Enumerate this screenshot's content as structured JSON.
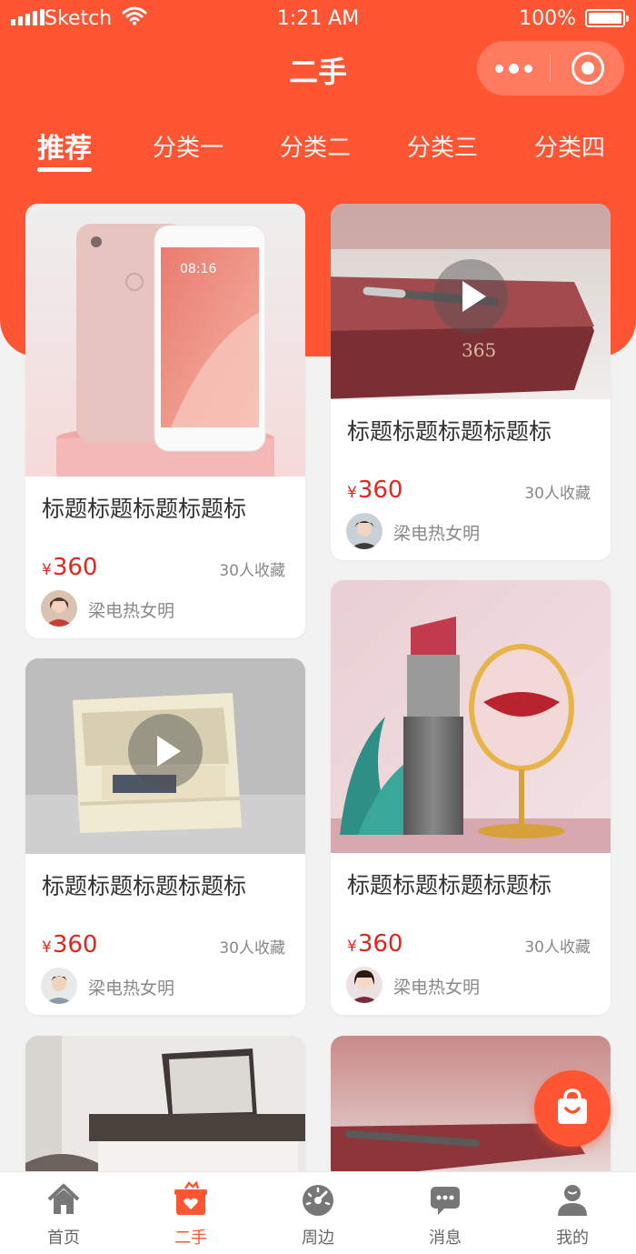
{
  "status_bar": {
    "carrier": "Sketch",
    "time": "1:21 AM",
    "battery": "100%"
  },
  "nav": {
    "title": "二手"
  },
  "tabs": [
    {
      "label": "推荐",
      "active": true
    },
    {
      "label": "分类一"
    },
    {
      "label": "分类二"
    },
    {
      "label": "分类三"
    },
    {
      "label": "分类四"
    }
  ],
  "products": [
    {
      "title": "标题标题标题标题标",
      "currency": "¥",
      "price": "360",
      "favorites": "30人收藏",
      "author": "梁电热女明",
      "image": "pink-smartphone",
      "has_video": false
    },
    {
      "title": "标题标题标题标题标",
      "currency": "¥",
      "price": "360",
      "favorites": "30人收藏",
      "author": "梁电热女明",
      "image": "red-notebook-365-with-pen",
      "has_video": true
    },
    {
      "title": "标题标题标题标题标",
      "currency": "¥",
      "price": "360",
      "favorites": "30人收藏",
      "author": "梁电热女明",
      "image": "white-wooden-nightstand",
      "has_video": true
    },
    {
      "title": "标题标题标题标题标",
      "currency": "¥",
      "price": "360",
      "favorites": "30人收藏",
      "author": "梁电热女明",
      "image": "lipstick-and-mirror",
      "has_video": false
    },
    {
      "image": "dressing-table"
    },
    {
      "image": "red-notebook"
    }
  ],
  "tabbar": [
    {
      "label": "首页",
      "icon": "home-icon"
    },
    {
      "label": "二手",
      "icon": "secondhand-bag-icon",
      "active": true
    },
    {
      "label": "周边",
      "icon": "speedometer-icon"
    },
    {
      "label": "消息",
      "icon": "message-icon"
    },
    {
      "label": "我的",
      "icon": "profile-icon"
    }
  ],
  "colors": {
    "accent": "#ff5533",
    "price": "#e5251d",
    "background": "#f2f2f2"
  }
}
